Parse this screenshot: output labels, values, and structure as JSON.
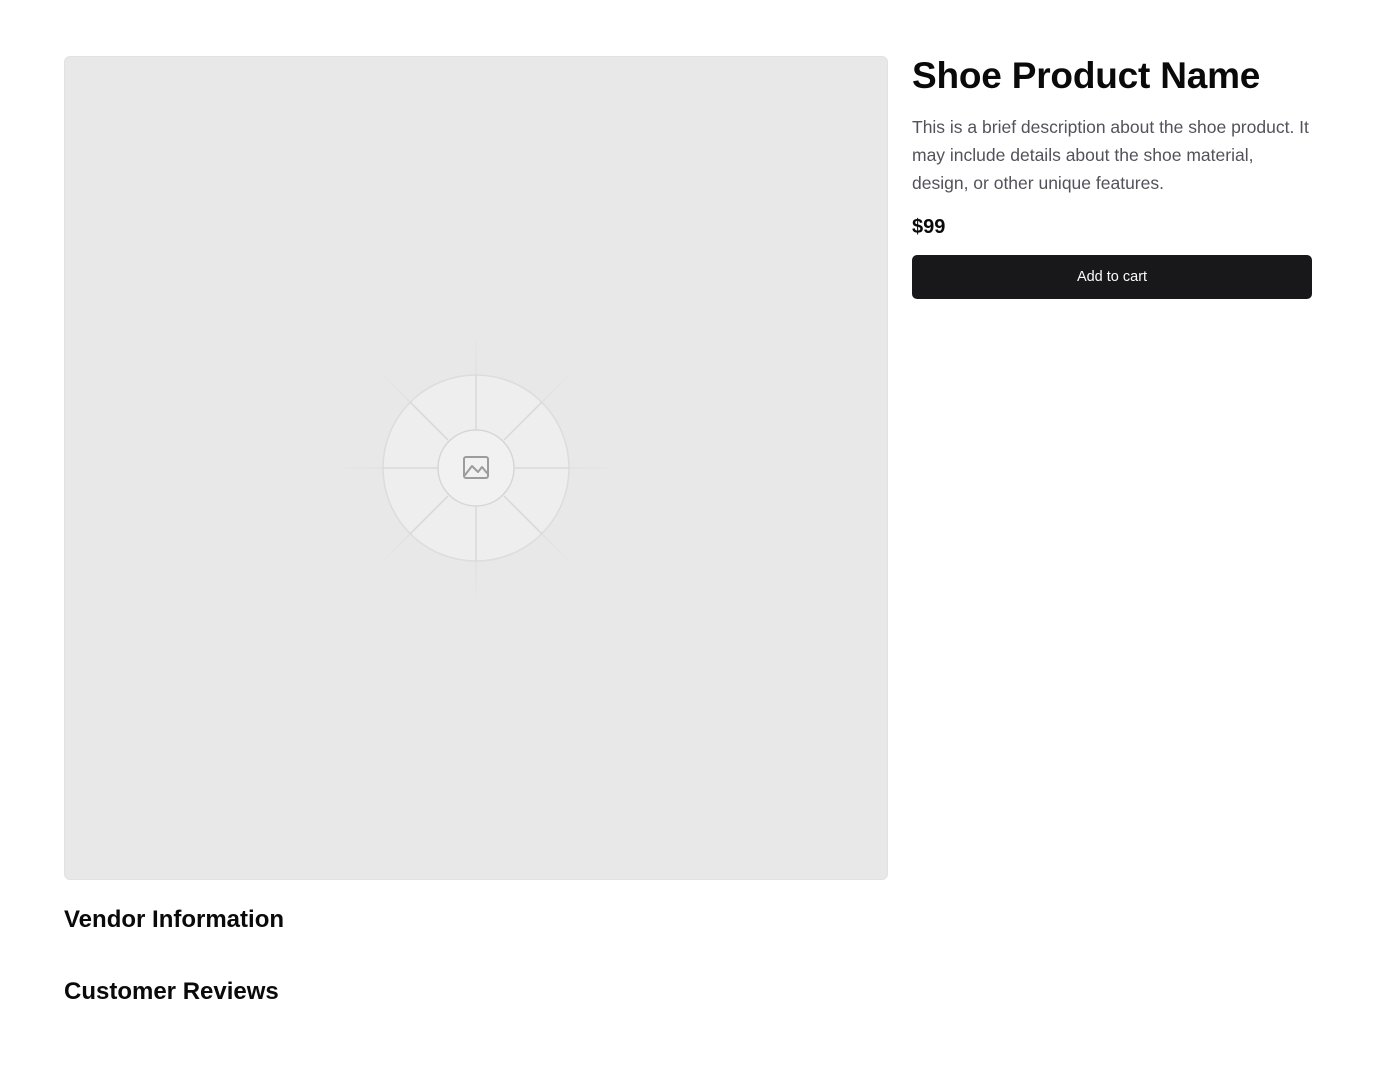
{
  "product": {
    "title": "Shoe Product Name",
    "description": "This is a brief description about the shoe product. It may include details about the shoe material, design, or other unique features.",
    "price": "$99",
    "add_to_cart_label": "Add to cart",
    "image_icon": "image-icon"
  },
  "sections": {
    "vendor_heading": "Vendor Information",
    "reviews_heading": "Customer Reviews"
  },
  "colors": {
    "button_background": "#18181b",
    "button_text": "#fafafa",
    "image_placeholder_background": "#e8e8e8",
    "description_text": "#52525b"
  }
}
